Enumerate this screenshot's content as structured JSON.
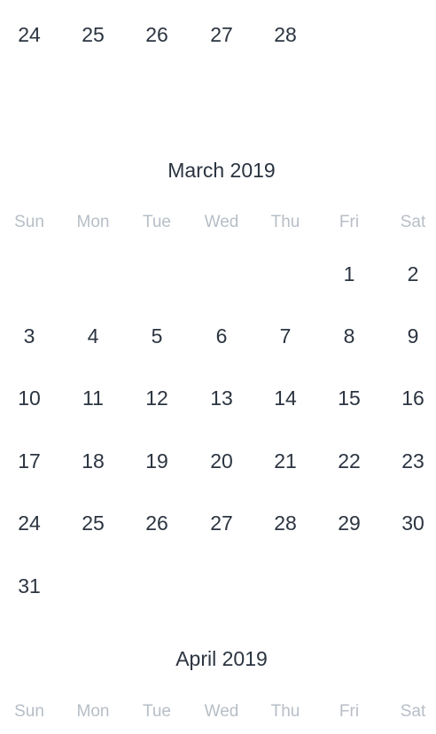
{
  "weekdays": [
    "Sun",
    "Mon",
    "Tue",
    "Wed",
    "Thu",
    "Fri",
    "Sat"
  ],
  "feb_partial": {
    "days": [
      "24",
      "25",
      "26",
      "27",
      "28"
    ]
  },
  "march": {
    "title": "March 2019",
    "weeks": [
      [
        "",
        "",
        "",
        "",
        "",
        "1",
        "2"
      ],
      [
        "3",
        "4",
        "5",
        "6",
        "7",
        "8",
        "9"
      ],
      [
        "10",
        "11",
        "12",
        "13",
        "14",
        "15",
        "16"
      ],
      [
        "17",
        "18",
        "19",
        "20",
        "21",
        "22",
        "23"
      ],
      [
        "24",
        "25",
        "26",
        "27",
        "28",
        "29",
        "30"
      ],
      [
        "31",
        "",
        "",
        "",
        "",
        "",
        ""
      ]
    ]
  },
  "april": {
    "title": "April 2019"
  }
}
